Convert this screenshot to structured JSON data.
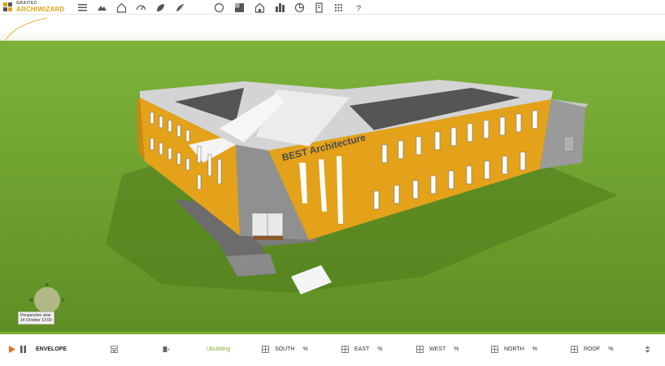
{
  "app": {
    "brand_small": "GRAITEC",
    "brand": "ARCHIWIZARD"
  },
  "toolbar": {
    "icons": [
      "menu-icon",
      "terrain-icon",
      "home-icon",
      "gauge-icon",
      "leaf-icon",
      "leaves-icon",
      "circle-icon",
      "texture-icon",
      "building-icon",
      "city-icon",
      "chart-icon",
      "document-icon",
      "grid-dots-icon",
      "help-icon"
    ]
  },
  "viewport": {
    "building_sign": "BEST Architecture",
    "view_label": "Perspective view",
    "date_label": "14 October 13:00",
    "compass": {
      "n": "N",
      "s": "S",
      "e": "E",
      "w": "W"
    }
  },
  "bottombar": {
    "envelope_label": "ENVELOPE",
    "ubuilding_label": "Ubuilding",
    "sections": [
      {
        "label": "SOUTH",
        "value": "%"
      },
      {
        "label": "EAST",
        "value": "%"
      },
      {
        "label": "WEST",
        "value": "%"
      },
      {
        "label": "NORTH",
        "value": "%"
      },
      {
        "label": "ROOF",
        "value": "%"
      }
    ]
  },
  "colors": {
    "ground": "#6ea12c",
    "facade": "#e3a21a",
    "accent_green": "#7eaf33",
    "roof": "#cfcfcf",
    "wall_grey": "#8c8c8c"
  }
}
